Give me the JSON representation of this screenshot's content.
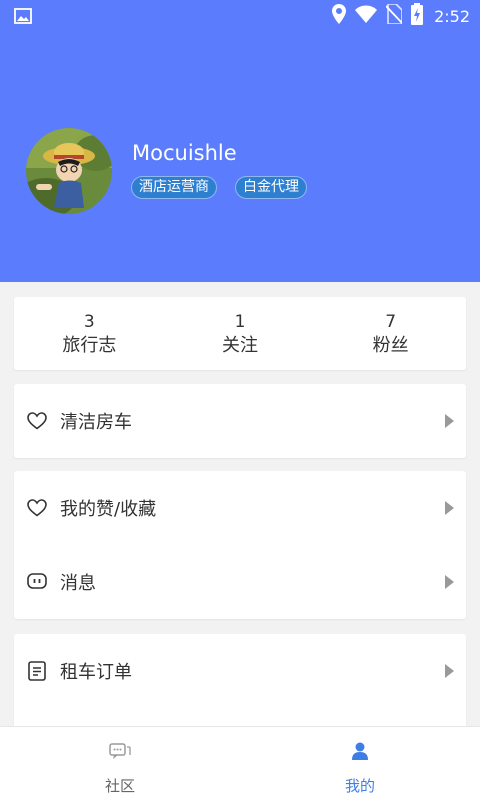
{
  "status_bar": {
    "time": "2:52"
  },
  "profile": {
    "username": "Mocuishle",
    "badges": [
      "酒店运营商",
      "白金代理"
    ]
  },
  "stats": [
    {
      "value": "3",
      "label": "旅行志"
    },
    {
      "value": "1",
      "label": "关注"
    },
    {
      "value": "7",
      "label": "粉丝"
    }
  ],
  "menu": {
    "clean_room_car": "清洁房车",
    "likes_favorites": "我的赞/收藏",
    "messages": "消息",
    "rental_orders": "租车订单"
  },
  "tabs": [
    {
      "label": "社区",
      "active": false
    },
    {
      "label": "我的",
      "active": true
    }
  ],
  "colors": {
    "header": "#5b7cfd",
    "badge": "#2f7fd0",
    "active_tab": "#3f7fe5"
  }
}
